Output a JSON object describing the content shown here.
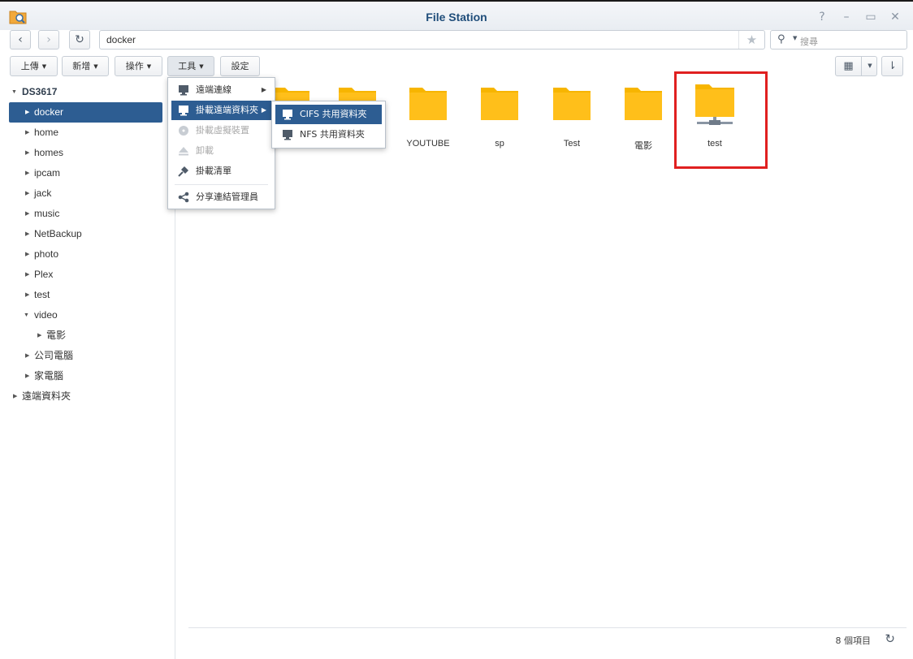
{
  "window": {
    "title": "File Station",
    "controls": [
      "?",
      "–",
      "▭",
      "✕"
    ]
  },
  "nav": {
    "path": "docker",
    "search_placeholder": "搜尋"
  },
  "toolbar": {
    "upload": "上傳",
    "create": "新增",
    "action": "操作",
    "tools": "工具",
    "settings": "設定"
  },
  "sidebar": {
    "root": "DS3617",
    "items": [
      "docker",
      "home",
      "homes",
      "ipcam",
      "jack",
      "music",
      "NetBackup",
      "photo",
      "Plex",
      "test",
      "video",
      "電影",
      "公司電腦",
      "家電腦"
    ],
    "remote": "遠端資料夾"
  },
  "tools_menu": {
    "items": [
      "遠端連線",
      "掛載遠端資料夾",
      "掛載虛擬裝置",
      "卸載",
      "掛載清單",
      "分享連結管理員"
    ]
  },
  "mount_submenu": {
    "items": [
      "CIFS 共用資料夾",
      "NFS 共用資料夾"
    ]
  },
  "folders": [
    "YOUTUBE",
    "sp",
    "Test",
    "電影",
    "test"
  ],
  "status": {
    "count": "8 個項目"
  },
  "colors": {
    "accent": "#2d5d92",
    "folder": "#f7b500",
    "highlight": "#e02020"
  }
}
